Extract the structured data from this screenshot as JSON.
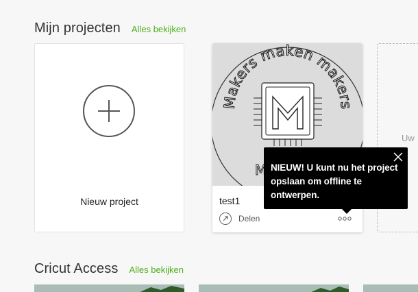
{
  "projects_section": {
    "title": "Mijn projecten",
    "see_all": "Alles bekijken"
  },
  "new_project": {
    "label": "Nieuw project",
    "icon": "plus-circle-icon"
  },
  "project_card": {
    "name": "test1",
    "thumbnail_text": "Makers maken makers",
    "share_label": "Delen",
    "share_icon": "share-arrow-icon",
    "more_icon": "more-dots-icon"
  },
  "partial_card": {
    "text": "Uw"
  },
  "tooltip": {
    "text": "NIEUW! U kunt nu het project opslaan om offline te ontwerpen.",
    "close_icon": "close-icon"
  },
  "access_section": {
    "title": "Cricut Access",
    "see_all": "Alles bekijken"
  },
  "colors": {
    "accent": "#4caf1a",
    "tooltip_bg": "#000000",
    "page_bg": "#f7f7f7"
  }
}
